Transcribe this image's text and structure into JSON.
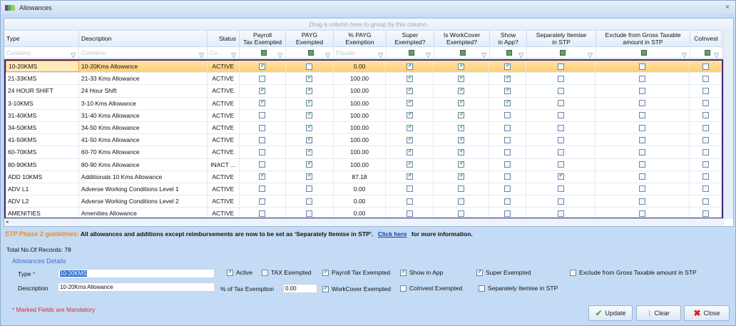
{
  "window": {
    "title": "Allowances",
    "close": "×"
  },
  "grid": {
    "group_hint": "Drag a column here to group by this column.",
    "columns": [
      {
        "label": "Type",
        "w": 105,
        "align": "l",
        "filter": "Contains:",
        "type": "text"
      },
      {
        "label": "Description",
        "w": 180,
        "align": "l",
        "filter": "Contains:",
        "type": "text"
      },
      {
        "label": "Status",
        "w": 45,
        "align": "r",
        "filter": "Co...",
        "type": "text"
      },
      {
        "label": "Payroll\nTax Exempted",
        "w": 65,
        "filter": "",
        "type": "check"
      },
      {
        "label": "PAYG\nExempted",
        "w": 67,
        "filter": "",
        "type": "check"
      },
      {
        "label": "% PAYG\nExemption",
        "w": 74,
        "filter": "Equals:",
        "type": "num"
      },
      {
        "label": "Super\nExempted?",
        "w": 67,
        "filter": "",
        "type": "check"
      },
      {
        "label": "Is WorkCover\nExempted?",
        "w": 78,
        "filter": "",
        "type": "check"
      },
      {
        "label": "Show\nin App?",
        "w": 52,
        "filter": "",
        "type": "check"
      },
      {
        "label": "Separately Itemise\nin STP",
        "w": 97,
        "filter": "",
        "type": "check"
      },
      {
        "label": "Exclude from Gross Taxable\namount in STP",
        "w": 132,
        "filter": "",
        "type": "check"
      },
      {
        "label": "CoInvest",
        "w": 45,
        "filter": "",
        "type": "check"
      }
    ],
    "rows": [
      [
        "10-20KMS",
        "10-20Kms Allowance",
        "ACTIVE",
        1,
        0,
        "0.00",
        1,
        1,
        1,
        0,
        0,
        0
      ],
      [
        "21-33KMS",
        "21-33 Kms Allowance",
        "ACTIVE",
        0,
        1,
        "100.00",
        1,
        1,
        1,
        0,
        0,
        0
      ],
      [
        "24 HOUR SHIFT",
        "24 Hour Shift",
        "ACTIVE",
        1,
        1,
        "100.00",
        1,
        1,
        1,
        0,
        0,
        0
      ],
      [
        "3-10KMS",
        "3-10 Kms Allowance",
        "ACTIVE",
        1,
        1,
        "100.00",
        1,
        1,
        1,
        0,
        0,
        0
      ],
      [
        "31-40KMS",
        "31-40 Kms Allowance",
        "ACTIVE",
        0,
        1,
        "100.00",
        1,
        1,
        0,
        0,
        0,
        0
      ],
      [
        "34-50KMS",
        "34-50 Kms Allowance",
        "ACTIVE",
        0,
        1,
        "100.00",
        1,
        1,
        0,
        0,
        0,
        0
      ],
      [
        "41-50KMS",
        "41-50 Kms Allowance",
        "ACTIVE",
        0,
        1,
        "100.00",
        1,
        1,
        0,
        0,
        0,
        0
      ],
      [
        "60-70KMS",
        "60-70 Kms Allowance",
        "ACTIVE",
        0,
        1,
        "100.00",
        1,
        1,
        0,
        0,
        0,
        0
      ],
      [
        "80-90KMS",
        "80-90 Kms Allowance",
        "INACT ...",
        0,
        1,
        "100.00",
        1,
        1,
        0,
        0,
        0,
        0
      ],
      [
        "ADD 10KMS",
        "Additionals 10 Kms Allowance",
        "ACTIVE",
        1,
        1,
        "87.18",
        1,
        1,
        0,
        1,
        0,
        0
      ],
      [
        "ADV L1",
        "Adverse Working Conditions Level 1",
        "ACTIVE",
        0,
        0,
        "0.00",
        0,
        0,
        0,
        0,
        0,
        0
      ],
      [
        "ADV L2",
        "Adverse Working Conditions Level 2",
        "ACTIVE",
        0,
        0,
        "0.00",
        0,
        0,
        0,
        0,
        0,
        0
      ],
      [
        "AMENITIES",
        "Amenities Allowance",
        "ACTIVE",
        0,
        0,
        "0.00",
        0,
        0,
        0,
        0,
        0,
        0
      ]
    ]
  },
  "stp": {
    "heading": "STP Phase 2 guidelines:",
    "text": "All allowances and additions except reimbursements are now to be set as ‘Separately Itemise in STP’.",
    "link": "Click  here",
    "suffix": "for more information."
  },
  "total": "Total No.Of Records: 78",
  "details": {
    "heading": "Allowances  Details",
    "type_label": "Type",
    "req": "*",
    "type_value": "10-20KMS",
    "desc_label": "Description",
    "desc_value": "10-20Kms Allowance",
    "pct_label": "% of Tax Exemption",
    "pct_value": "0.00",
    "checks": {
      "active": "Active",
      "tax": "TAX Exempted",
      "payroll": "Payroll Tax Exempted",
      "show": "Show in App",
      "super": "Super Exempted",
      "exclude": "Exclude from Gross Taxable amount in STP",
      "workcover": "WorkCover Exempted",
      "coinvest": "CoInvest Exempted",
      "sep": "Separately Itemise in STP"
    },
    "mandatory": "* Marked Fields are Mandatory"
  },
  "buttons": {
    "update": "Update",
    "clear": "Clear",
    "close": "Close"
  }
}
